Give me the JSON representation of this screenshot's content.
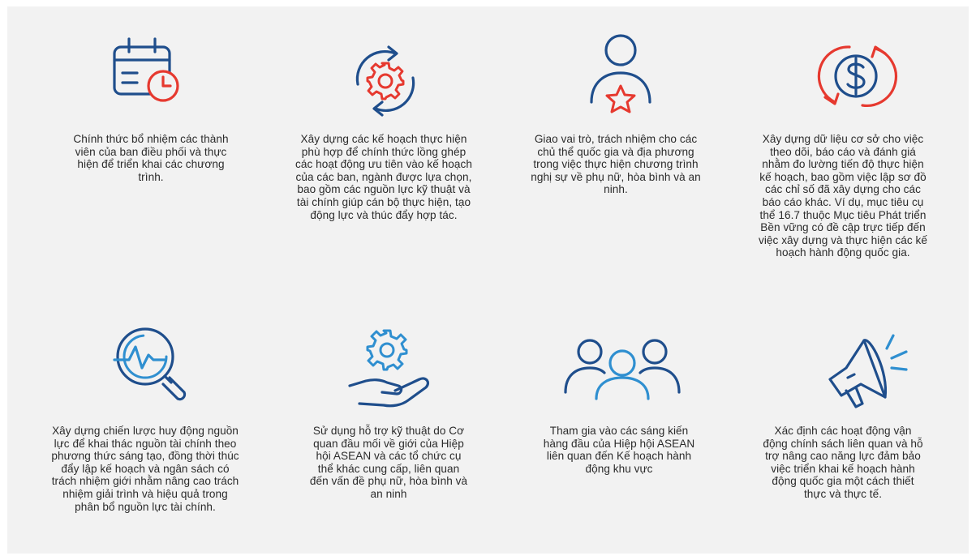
{
  "colors": {
    "dark_blue": "#1f4e8c",
    "light_blue": "#2f8fd0",
    "red": "#e6392f",
    "background": "#f2f2f2",
    "text": "#2b2b2b"
  },
  "items": [
    {
      "icon": "calendar-clock-icon",
      "text": "Chính thức bổ nhiệm các thành viên của ban điều phối và thực hiện để triển khai các chương trình."
    },
    {
      "icon": "gear-cycle-icon",
      "text": "Xây dựng các kế hoạch thực hiện phù hợp để chính thức lồng ghép các hoạt động ưu tiên vào kế hoạch của các ban, ngành được lựa chọn, bao gồm các nguồn lực kỹ thuật và tài chính giúp cán bộ thực hiện, tạo động lực và thúc đẩy hợp tác."
    },
    {
      "icon": "person-star-icon",
      "text": "Giao vai trò, trách nhiệm cho các chủ thể quốc gia và địa phương trong việc thực hiện chương trình nghị sự về phụ nữ, hòa bình và an ninh."
    },
    {
      "icon": "dollar-cycle-icon",
      "text": "Xây dựng dữ liệu cơ sở cho việc theo dõi, báo cáo và đánh giá nhằm đo lường tiến độ thực hiện kế hoạch, bao gồm việc lập sơ đồ các chỉ số đã xây dựng cho các báo cáo khác. Ví dụ, mục tiêu cụ thể 16.7 thuộc Mục tiêu Phát triển Bền vững có đề cập trực tiếp đến việc xây dựng và thực hiện các kế hoạch hành động quốc gia."
    },
    {
      "icon": "magnifier-pulse-icon",
      "text": "Xây dựng chiến lược huy động nguồn lực để khai thác nguồn tài chính theo phương thức sáng tạo, đồng thời thúc đẩy lập kế hoạch và ngân sách có trách nhiệm giới nhằm nâng cao trách nhiệm giải trình và hiệu quả trong phân bổ nguồn lực tài chính."
    },
    {
      "icon": "hand-gear-icon",
      "text": "Sử dụng hỗ trợ kỹ thuật do Cơ quan đầu mối về giới của Hiệp hội ASEAN và các tổ chức cụ thể khác cung cấp, liên quan đến vấn đề phụ nữ, hòa bình và an ninh"
    },
    {
      "icon": "group-people-icon",
      "text": "Tham gia vào các sáng kiến hàng đầu của Hiệp hội ASEAN liên quan đến Kế hoạch hành động khu vực"
    },
    {
      "icon": "megaphone-icon",
      "text": "Xác định các hoạt động vận động chính sách liên quan và hỗ trợ nâng cao năng lực đảm bảo việc triển khai kế hoạch hành động quốc gia một cách thiết thực và thực tế."
    }
  ]
}
